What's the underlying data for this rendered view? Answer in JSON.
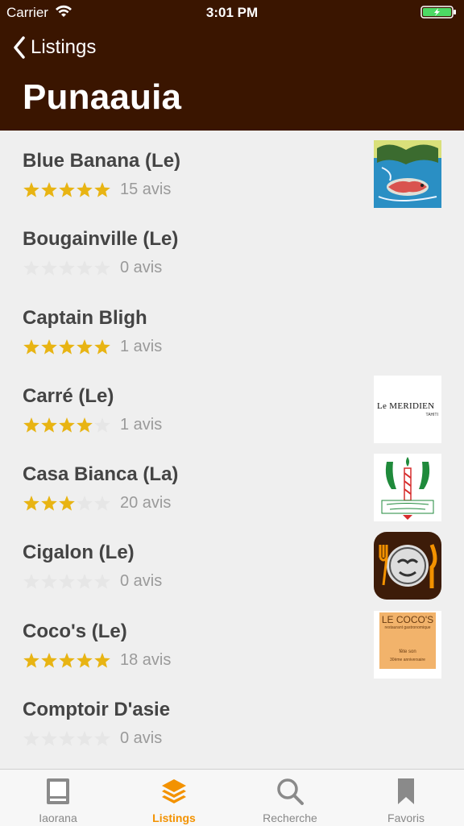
{
  "status_bar": {
    "carrier": "Carrier",
    "time": "3:01 PM"
  },
  "nav": {
    "back_label": "Listings",
    "title": "Punaauia"
  },
  "colors": {
    "header_bg": "#3a1500",
    "star_filled": "#e8b413",
    "star_empty": "#e6e6e6",
    "accent": "#f39200"
  },
  "listings": [
    {
      "name": "Blue Banana (Le)",
      "rating": 5,
      "reviews": "15 avis",
      "thumb": "blue-banana-logo"
    },
    {
      "name": "Bougainville (Le)",
      "rating": 0,
      "reviews": "0 avis",
      "thumb": ""
    },
    {
      "name": "Captain Bligh",
      "rating": 5,
      "reviews": "1 avis",
      "thumb": ""
    },
    {
      "name": "Carré (Le)",
      "rating": 4,
      "reviews": "1 avis",
      "thumb": "le-meridien-logo",
      "thumb_text": "Le MERIDIEN",
      "thumb_sub": "TAHITI"
    },
    {
      "name": "Casa Bianca (La)",
      "rating": 3,
      "reviews": "20 avis",
      "thumb": "casa-bianca-logo"
    },
    {
      "name": "Cigalon (Le)",
      "rating": 0,
      "reviews": "0 avis",
      "thumb": "cigalon-logo"
    },
    {
      "name": "Coco's (Le)",
      "rating": 5,
      "reviews": "18 avis",
      "thumb": "le-cocos-logo",
      "thumb_text": "LE COCO'S",
      "thumb_sub": "restaurant gastronomique",
      "thumb_sub2": "fête son",
      "thumb_sub3": "30ème anniversaire"
    },
    {
      "name": "Comptoir D'asie",
      "rating": 0,
      "reviews": "0 avis",
      "thumb": ""
    }
  ],
  "tabs": [
    {
      "label": "Iaorana",
      "icon": "book-icon",
      "active": false
    },
    {
      "label": "Listings",
      "icon": "layers-icon",
      "active": true
    },
    {
      "label": "Recherche",
      "icon": "search-icon",
      "active": false
    },
    {
      "label": "Favoris",
      "icon": "bookmark-icon",
      "active": false
    }
  ]
}
